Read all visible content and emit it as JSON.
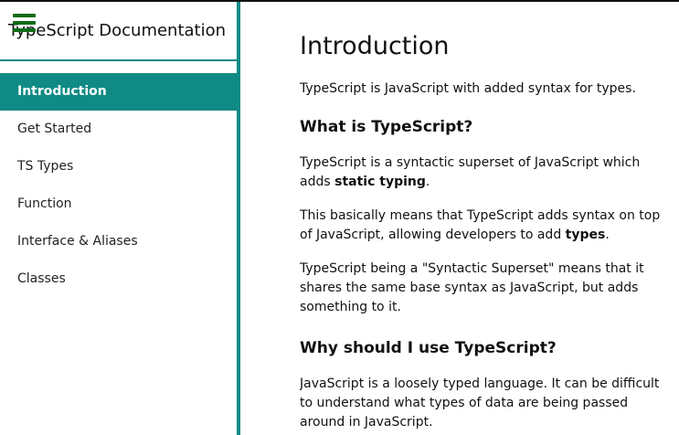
{
  "sidebar": {
    "title": "TypeScript Documentation",
    "menu_icon": "hamburger-menu-icon",
    "items": [
      {
        "label": "Introduction",
        "active": true
      },
      {
        "label": "Get Started",
        "active": false
      },
      {
        "label": "TS Types",
        "active": false
      },
      {
        "label": "Function",
        "active": false
      },
      {
        "label": "Interface & Aliases",
        "active": false
      },
      {
        "label": "Classes",
        "active": false
      }
    ]
  },
  "main": {
    "title": "Introduction",
    "intro": "TypeScript is JavaScript with added syntax for types.",
    "sections": [
      {
        "heading": "What is TypeScript?",
        "paragraphs": [
          {
            "before": "TypeScript is a syntactic superset of JavaScript which adds ",
            "bold": "static typing",
            "after": "."
          },
          {
            "before": "This basically means that TypeScript adds syntax on top of JavaScript, allowing developers to add ",
            "bold": "types",
            "after": "."
          },
          {
            "text": "TypeScript being a \"Syntactic Superset\" means that it shares the same base syntax as JavaScript, but adds something to it."
          }
        ]
      },
      {
        "heading": "Why should I use TypeScript?",
        "paragraphs": [
          {
            "text": "JavaScript is a loosely typed language. It can be difficult to understand what types of data are being passed around in JavaScript."
          }
        ]
      }
    ]
  },
  "colors": {
    "accent": "#0f8a85",
    "menu_icon": "#106b17",
    "text": "#111111"
  }
}
